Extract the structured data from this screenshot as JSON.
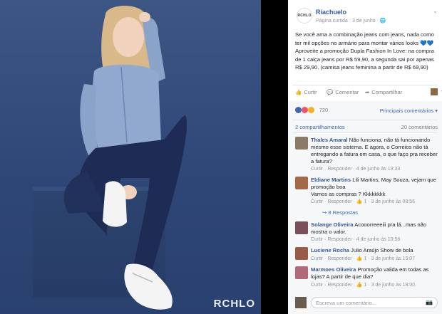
{
  "photo": {
    "brand_watermark": "RCHLO",
    "background_color": "#33497a"
  },
  "post": {
    "page_name": "Riachuelo",
    "avatar_logo": "RCHLO",
    "meta": "Página curtida · 3 de junho · ",
    "globe_icon": "globe-icon",
    "body": "Se você ama a combinação jeans com jeans, nada como ter mil opções no armário para montar vários looks 💙💙 Aproveite a promoção Dupla Fashion In Love: na compra de 1 calça jeans por R$ 59,90, a segunda sai por apenas R$ 29,90. (camisa jeans feminina a partir de R$ 69,90)",
    "actions": {
      "like": "Curtir",
      "comment": "Comentar",
      "share": "Compartilhar"
    },
    "reactions_count": "720",
    "top_comments_label": "Principais comentários ▾",
    "shares": "2 compartilhamentos",
    "comments_count": "20 comentários",
    "comments": [
      {
        "author": "Thales Amaral",
        "text": "Não funciona, não tá funcionando mesmo esse sistema. E agora, o Correios não tá entregando a fatura em casa, o que faço pra receber a fatura?",
        "footer": "Curtir · Responder · 4 de junho às 13:33",
        "avatar_color": "#8b7a66"
      },
      {
        "author": "Eldiane Martins",
        "text": "Lili Martins, May Souza, vejam que promoção boa\nVamos as compras ? Kkkkkkkk",
        "footer": "Curtir · Responder · 👍 1 · 3 de junho às 08:56",
        "avatar_color": "#a36a4a",
        "replies_label": "↪ 8 Respostas"
      },
      {
        "author": "Solange Oliveira",
        "text": "Acooorreeeiii pra lá...mas não mostra o valor.",
        "footer": "Curtir · Responder · 4 de junho às 10:56",
        "avatar_color": "#7a4e5a"
      },
      {
        "author": "Luciene Rocha",
        "text": "Julio Araújo Show de bola",
        "footer": "Curtir · Responder · 👍 1 · 3 de junho às 15:07",
        "avatar_color": "#9a5a48"
      },
      {
        "author": "Marmoes Oliveira",
        "text": "Promoção valida em todas as lojas? A partir de que dia?",
        "footer": "Curtir · Responder · 👍 1 · 3 de junho às 18:00",
        "avatar_color": "#b06a78"
      }
    ],
    "composer_placeholder": "Escreva um comentário...",
    "camera_icon": "camera-icon"
  }
}
